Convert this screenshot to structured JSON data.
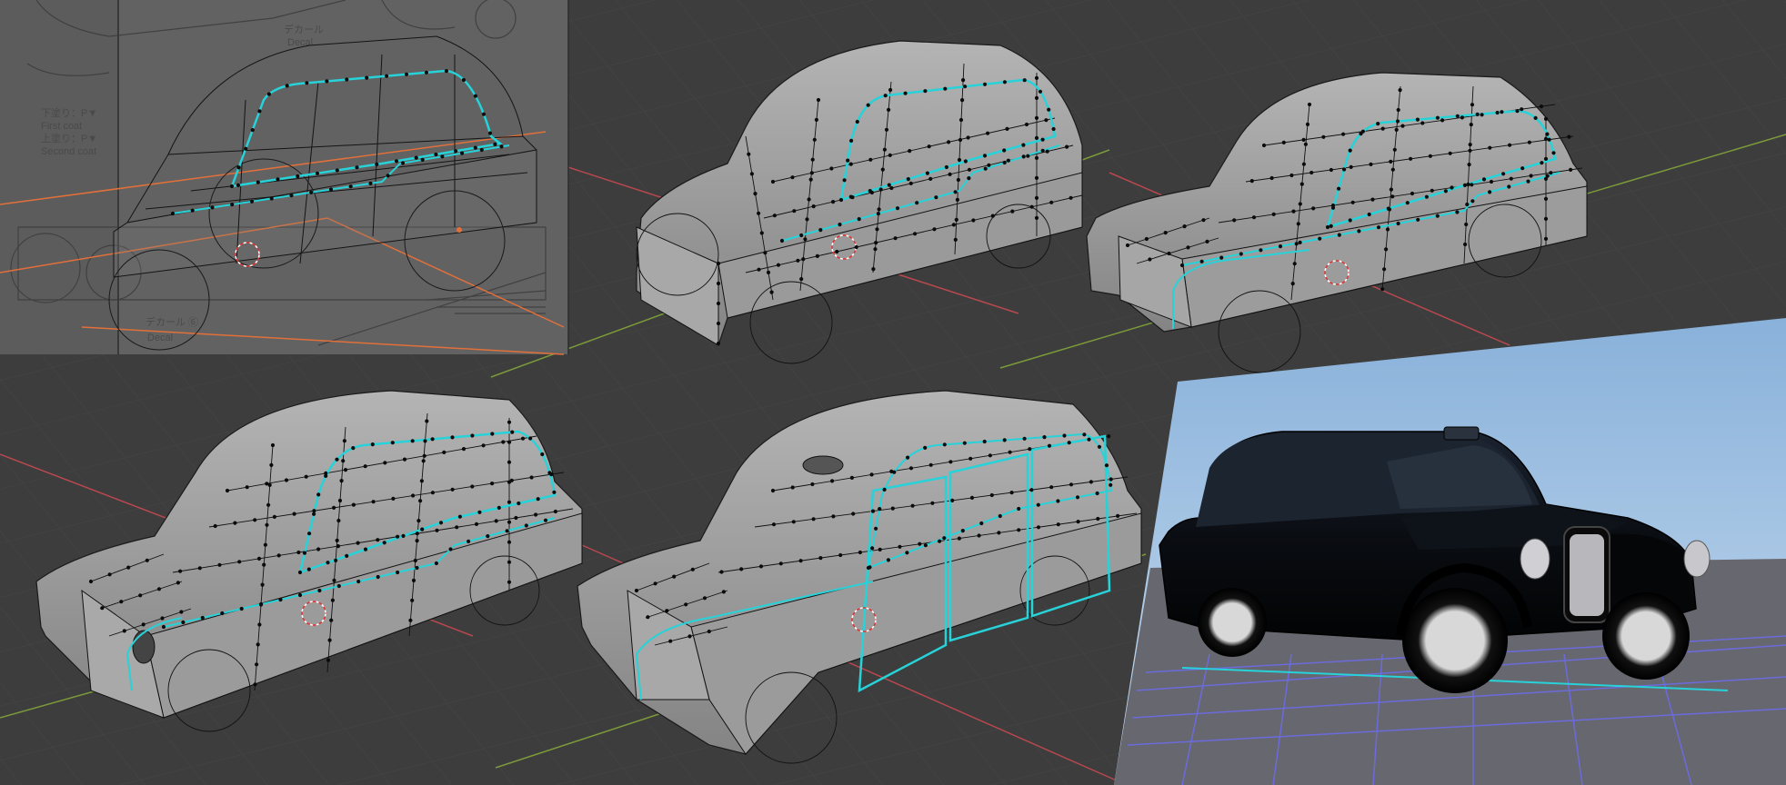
{
  "reference_blueprint": {
    "labels": {
      "undercoat_jp": "下塗り：P▼",
      "first_coat": "First coat",
      "topcoat_jp": "上塗り：P▼",
      "second_coat": "Second coat",
      "decal_jp_top": "デカール",
      "decal_top": "Decal",
      "decal_jp_bottom": "デカール ⑥",
      "decal_bottom": "Decal"
    }
  },
  "stages": [
    {
      "name": "stage-1-blueprint-blockout"
    },
    {
      "name": "stage-2-cabin-loop"
    },
    {
      "name": "stage-3-bonnet-detail"
    },
    {
      "name": "stage-4-front-end"
    },
    {
      "name": "stage-5-door-panels"
    },
    {
      "name": "stage-6-shaded-render"
    }
  ],
  "colors": {
    "viewport_bg": "#3d3d3d",
    "grid": "#4a4a4a",
    "x_axis": "#b8484f",
    "y_axis": "#7b9a3a",
    "mesh_fill": "#8f8f8f",
    "selected_edge": "#27d2d8",
    "vertex": "#0b0b0b",
    "sky_top": "#8fb6de",
    "sky_bottom": "#c2d8ee",
    "ground": "#6a6a72",
    "render_grid": "#6c6cf0",
    "taxi_body": "#0a0c10"
  }
}
